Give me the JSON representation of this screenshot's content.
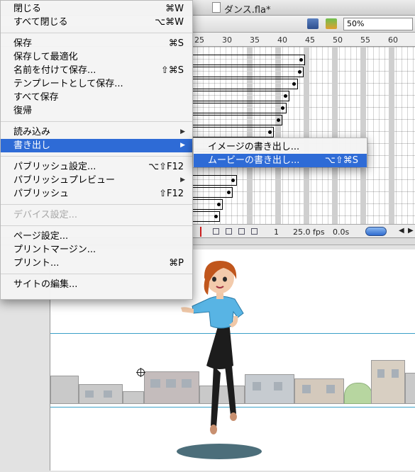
{
  "window": {
    "title": "ダンス.fla*",
    "zoom": "50%"
  },
  "timeline": {
    "ruler_ticks": [
      "25",
      "30",
      "35",
      "40",
      "45",
      "50",
      "55",
      "60"
    ],
    "frame": "1",
    "fps": "25.0 fps",
    "time": "0.0s"
  },
  "file_menu": {
    "close": {
      "label": "閉じる",
      "shortcut": "⌘W"
    },
    "close_all": {
      "label": "すべて閉じる",
      "shortcut": "⌥⌘W"
    },
    "save": {
      "label": "保存",
      "shortcut": "⌘S"
    },
    "save_compact": {
      "label": "保存して最適化"
    },
    "save_as": {
      "label": "名前を付けて保存...",
      "shortcut": "⇧⌘S"
    },
    "save_template": {
      "label": "テンプレートとして保存..."
    },
    "save_all": {
      "label": "すべて保存"
    },
    "revert": {
      "label": "復帰"
    },
    "import": {
      "label": "読み込み"
    },
    "export": {
      "label": "書き出し"
    },
    "publish_settings": {
      "label": "パブリッシュ設定...",
      "shortcut": "⌥⇧F12"
    },
    "publish_preview": {
      "label": "パブリッシュプレビュー"
    },
    "publish": {
      "label": "パブリッシュ",
      "shortcut": "⇧F12"
    },
    "device_settings": {
      "label": "デバイス設定..."
    },
    "page_setup": {
      "label": "ページ設定..."
    },
    "print_margins": {
      "label": "プリントマージン..."
    },
    "print": {
      "label": "プリント...",
      "shortcut": "⌘P"
    },
    "edit_sites": {
      "label": "サイトの編集..."
    }
  },
  "export_submenu": {
    "export_image": {
      "label": "イメージの書き出し..."
    },
    "export_movie": {
      "label": "ムービーの書き出し...",
      "shortcut": "⌥⇧⌘S"
    }
  },
  "colors": {
    "menu_highlight": "#2e6bd6",
    "guide": "#3aa0c8"
  }
}
